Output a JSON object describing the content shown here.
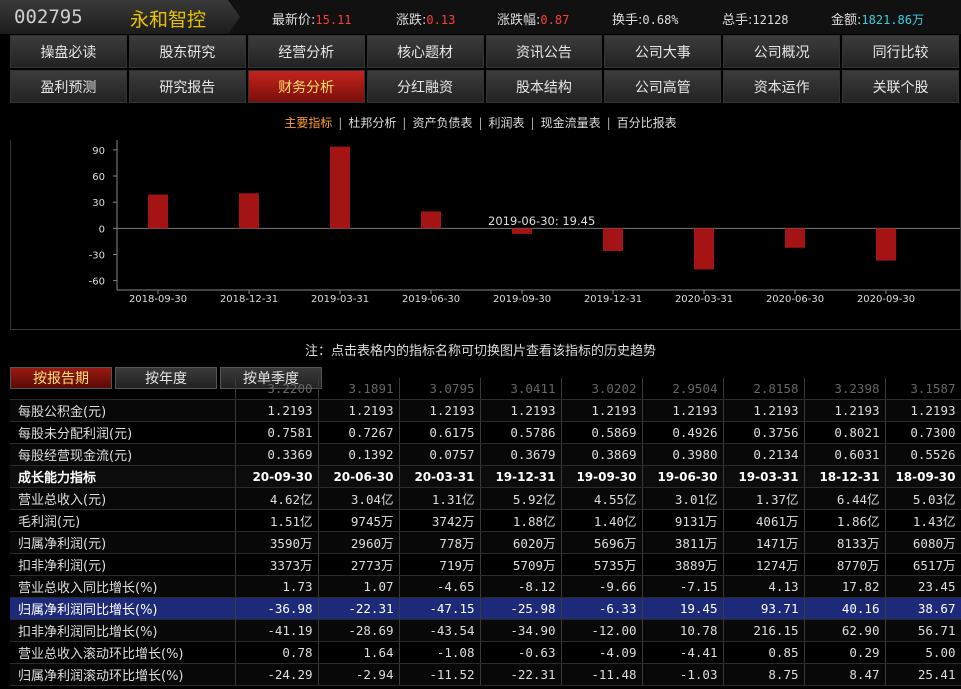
{
  "header": {
    "code": "002795",
    "name": "永和智控",
    "fields": [
      {
        "label": "最新价:",
        "value": "15.11",
        "color": "red"
      },
      {
        "label": "涨跌:",
        "value": "0.13",
        "color": "red"
      },
      {
        "label": "涨跌幅:",
        "value": "0.87",
        "color": "red"
      },
      {
        "label": "换手:",
        "value": "0.68%",
        "color": "white"
      },
      {
        "label": "总手:",
        "value": "12128",
        "color": "white"
      },
      {
        "label": "金额:",
        "value": "1821.86万",
        "color": "cyan"
      }
    ]
  },
  "nav_row1": [
    "操盘必读",
    "股东研究",
    "经营分析",
    "核心题材",
    "资讯公告",
    "公司大事",
    "公司概况",
    "同行比较"
  ],
  "nav_row2": [
    "盈利预测",
    "研究报告",
    "财务分析",
    "分红融资",
    "股本结构",
    "公司高管",
    "资本运作",
    "关联个股"
  ],
  "nav_active": "财务分析",
  "subtabs": [
    "主要指标",
    "杜邦分析",
    "资产负债表",
    "利润表",
    "现金流量表",
    "百分比报表"
  ],
  "subtab_active": "主要指标",
  "chart_data": {
    "type": "bar",
    "categories": [
      "2018-09-30",
      "2018-12-31",
      "2019-03-31",
      "2019-06-30",
      "2019-09-30",
      "2019-12-31",
      "2020-03-31",
      "2020-06-30",
      "2020-09-30"
    ],
    "values": [
      38.67,
      40.16,
      93.71,
      19.45,
      -6.33,
      -25.98,
      -47.15,
      -22.31,
      -36.98
    ],
    "yticks": [
      90,
      60,
      30,
      0,
      -30,
      -60
    ],
    "ylim": [
      -65,
      95
    ],
    "tooltip": "2019-06-30: 19.45",
    "bar_color": "#a51414",
    "grid": false
  },
  "note": "注：点击表格内的指标名称可切换图片查看该指标的历史趋势",
  "period_tabs": [
    "按报告期",
    "按年度",
    "按单季度"
  ],
  "period_active": "按报告期",
  "table": {
    "cut_row": [
      "",
      "3.2200",
      "3.1891",
      "3.0795",
      "3.0411",
      "3.0202",
      "2.9504",
      "2.8158",
      "3.2398",
      "3.1587"
    ],
    "rows_a": [
      [
        "每股公积金(元)",
        "1.2193",
        "1.2193",
        "1.2193",
        "1.2193",
        "1.2193",
        "1.2193",
        "1.2193",
        "1.2193",
        "1.2193"
      ],
      [
        "每股未分配利润(元)",
        "0.7581",
        "0.7267",
        "0.6175",
        "0.5786",
        "0.5869",
        "0.4926",
        "0.3756",
        "0.8021",
        "0.7300"
      ],
      [
        "每股经营现金流(元)",
        "0.3369",
        "0.1392",
        "0.0757",
        "0.3679",
        "0.3869",
        "0.3980",
        "0.2134",
        "0.6031",
        "0.5526"
      ]
    ],
    "section": [
      "成长能力指标",
      "20-09-30",
      "20-06-30",
      "20-03-31",
      "19-12-31",
      "19-09-30",
      "19-06-30",
      "19-03-31",
      "18-12-31",
      "18-09-30"
    ],
    "rows_b": [
      [
        "营业总收入(元)",
        "4.62亿",
        "3.04亿",
        "1.31亿",
        "5.92亿",
        "4.55亿",
        "3.01亿",
        "1.37亿",
        "6.44亿",
        "5.03亿"
      ],
      [
        "毛利润(元)",
        "1.51亿",
        "9745万",
        "3742万",
        "1.88亿",
        "1.40亿",
        "9131万",
        "4061万",
        "1.86亿",
        "1.43亿"
      ],
      [
        "归属净利润(元)",
        "3590万",
        "2960万",
        "778万",
        "6020万",
        "5696万",
        "3811万",
        "1471万",
        "8133万",
        "6080万"
      ],
      [
        "扣非净利润(元)",
        "3373万",
        "2773万",
        "719万",
        "5709万",
        "5735万",
        "3889万",
        "1274万",
        "8770万",
        "6517万"
      ],
      [
        "营业总收入同比增长(%)",
        "1.73",
        "1.07",
        "-4.65",
        "-8.12",
        "-9.66",
        "-7.15",
        "4.13",
        "17.82",
        "23.45"
      ],
      [
        "归属净利润同比增长(%)",
        "-36.98",
        "-22.31",
        "-47.15",
        "-25.98",
        "-6.33",
        "19.45",
        "93.71",
        "40.16",
        "38.67"
      ],
      [
        "扣非净利润同比增长(%)",
        "-41.19",
        "-28.69",
        "-43.54",
        "-34.90",
        "-12.00",
        "10.78",
        "216.15",
        "62.90",
        "56.71"
      ],
      [
        "营业总收入滚动环比增长(%)",
        "0.78",
        "1.64",
        "-1.08",
        "-0.63",
        "-4.09",
        "-4.41",
        "0.85",
        "0.29",
        "5.00"
      ],
      [
        "归属净利润滚动环比增长(%)",
        "-24.29",
        "-2.94",
        "-11.52",
        "-22.31",
        "-11.48",
        "-1.03",
        "8.75",
        "8.47",
        "25.41"
      ]
    ],
    "highlight_label": "归属净利润同比增长(%)"
  }
}
